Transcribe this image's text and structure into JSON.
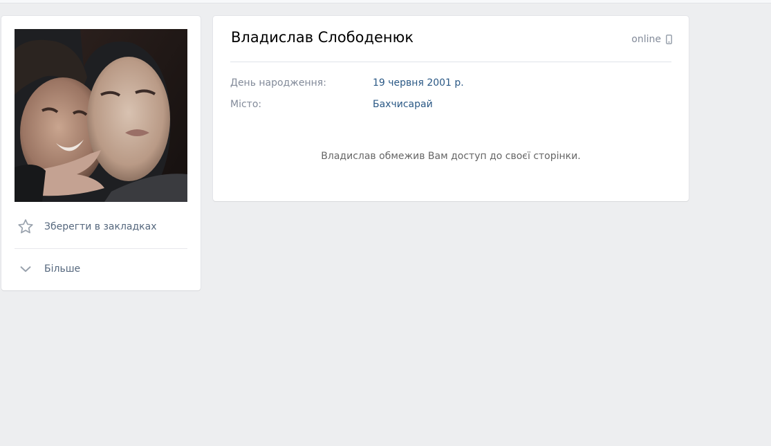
{
  "profile": {
    "name": "Владислав Слободенюк",
    "status": "online",
    "info": [
      {
        "label": "День народження:",
        "value": "19 червня 2001 р."
      },
      {
        "label": "Місто:",
        "value": "Бахчисарай"
      }
    ],
    "private_message": "Владислав обмежив Вам доступ до своєї сторінки."
  },
  "sidebar": {
    "bookmark_label": "Зберегти в закладках",
    "more_label": "Більше"
  },
  "icons": {
    "bookmark": "star-icon",
    "more": "chevron-down-icon",
    "status": "mobile-phone-icon"
  },
  "colors": {
    "background": "#edeef0",
    "card": "#ffffff",
    "link": "#2a5885",
    "muted": "#828a99"
  }
}
